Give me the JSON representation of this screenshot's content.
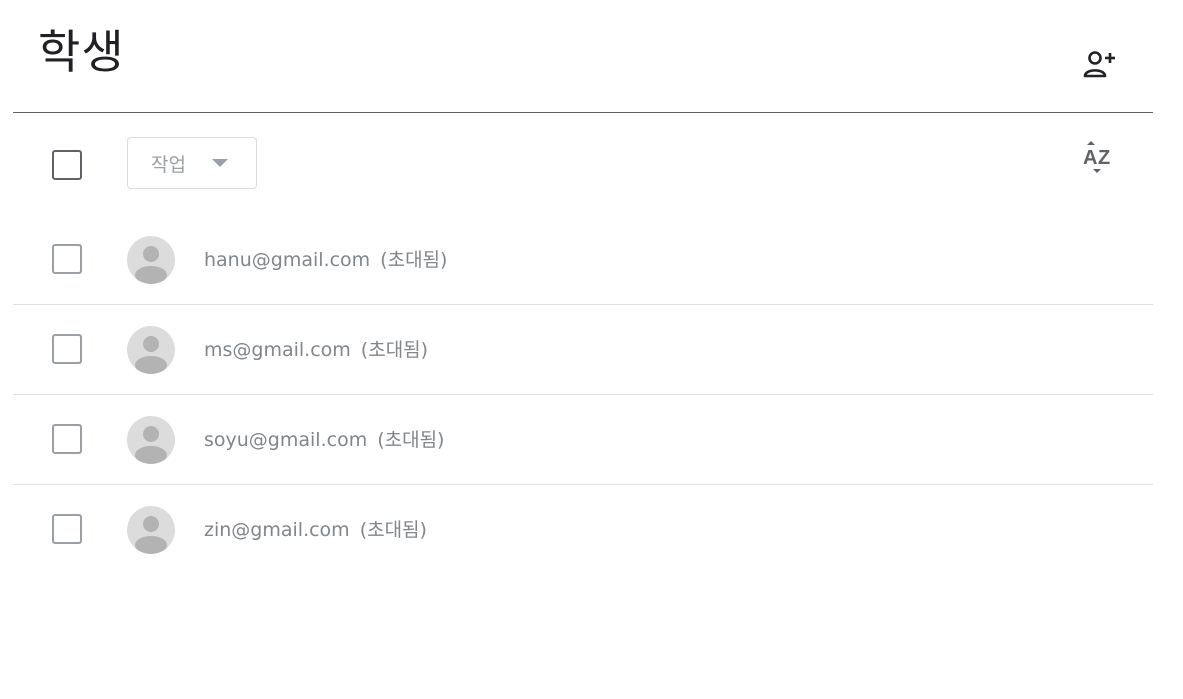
{
  "header": {
    "title": "학생",
    "invite_icon": "person-add-icon"
  },
  "toolbar": {
    "action_label": "작업",
    "sort_icon": "sort-az-icon"
  },
  "students": [
    {
      "email": "hanu@gmail.com",
      "status": "(초대됨)"
    },
    {
      "email": "ms@gmail.com",
      "status": "(초대됨)"
    },
    {
      "email": "soyu@gmail.com",
      "status": "(초대됨)"
    },
    {
      "email": "zin@gmail.com",
      "status": "(초대됨)"
    }
  ],
  "colors": {
    "text_primary": "#202124",
    "text_secondary": "#80868b",
    "divider": "#e0e0e0",
    "avatar_bg": "#dcdcdc"
  }
}
